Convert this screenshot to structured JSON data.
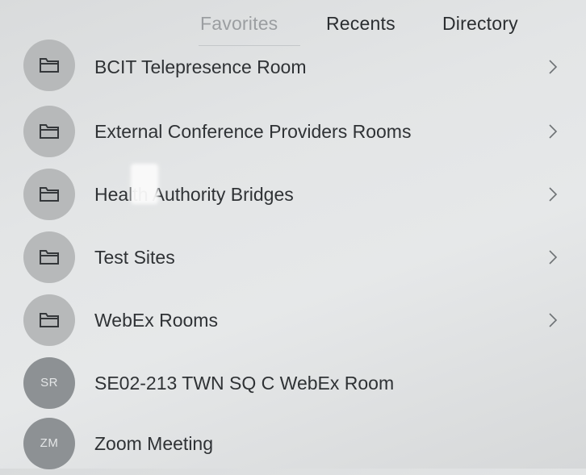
{
  "tabs": {
    "favorites": "Favorites",
    "recents": "Recents",
    "directory": "Directory"
  },
  "items": [
    {
      "label": "BCIT Telepresence Room",
      "type": "folder",
      "icon": "folder-icon"
    },
    {
      "label": "External Conference Providers Rooms",
      "type": "folder",
      "icon": "folder-icon"
    },
    {
      "label": "Health Authority Bridges",
      "type": "folder",
      "icon": "folder-icon"
    },
    {
      "label": "Test Sites",
      "type": "folder",
      "icon": "folder-icon"
    },
    {
      "label": "WebEx Rooms",
      "type": "folder",
      "icon": "folder-icon"
    },
    {
      "label": "SE02-213 TWN SQ C WebEx Room",
      "type": "contact",
      "initials": "SR"
    },
    {
      "label": "Zoom Meeting",
      "type": "contact",
      "initials": "ZM"
    }
  ],
  "colors": {
    "background": "#e3e5e6",
    "avatar_folder": "#b7b9ba",
    "avatar_contact": "#8d9194",
    "tab_active": "#9b9ea1",
    "text": "#2f3235"
  }
}
